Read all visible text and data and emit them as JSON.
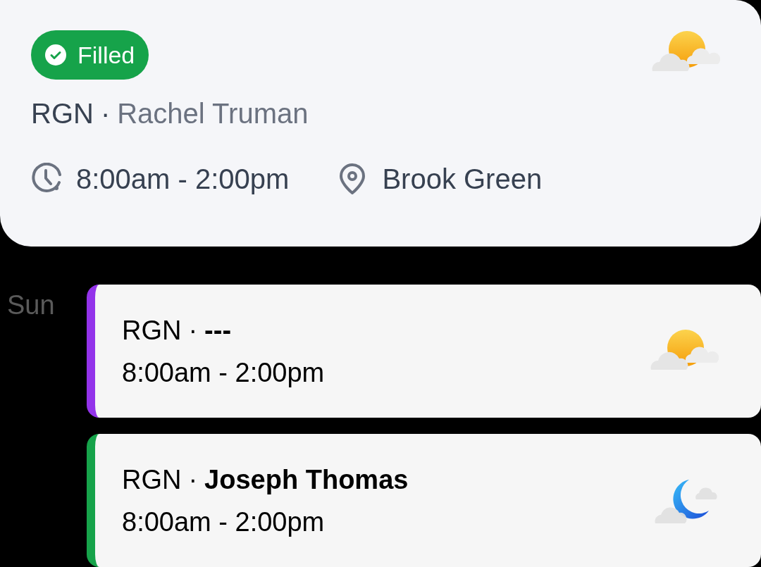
{
  "shift_detail": {
    "status": {
      "kind": "filled",
      "label": "Filled"
    },
    "role": "RGN",
    "separator": "·",
    "assignee": "Rachel Truman",
    "time": "8:00am - 2:00pm",
    "location": "Brook Green",
    "weather_icon": {
      "kind": "day"
    }
  },
  "day_group": {
    "day": "Sun",
    "shifts": [
      {
        "role": "RGN",
        "separator": "·",
        "assignee": "---",
        "time": "8:00am - 2:00pm",
        "color": "#9333ea",
        "weather_icon": {
          "kind": "day"
        }
      },
      {
        "role": "RGN",
        "separator": "·",
        "assignee": "Joseph Thomas",
        "time": "8:00am - 2:00pm",
        "color": "#16a34a",
        "weather_icon": {
          "kind": "night"
        }
      }
    ]
  }
}
